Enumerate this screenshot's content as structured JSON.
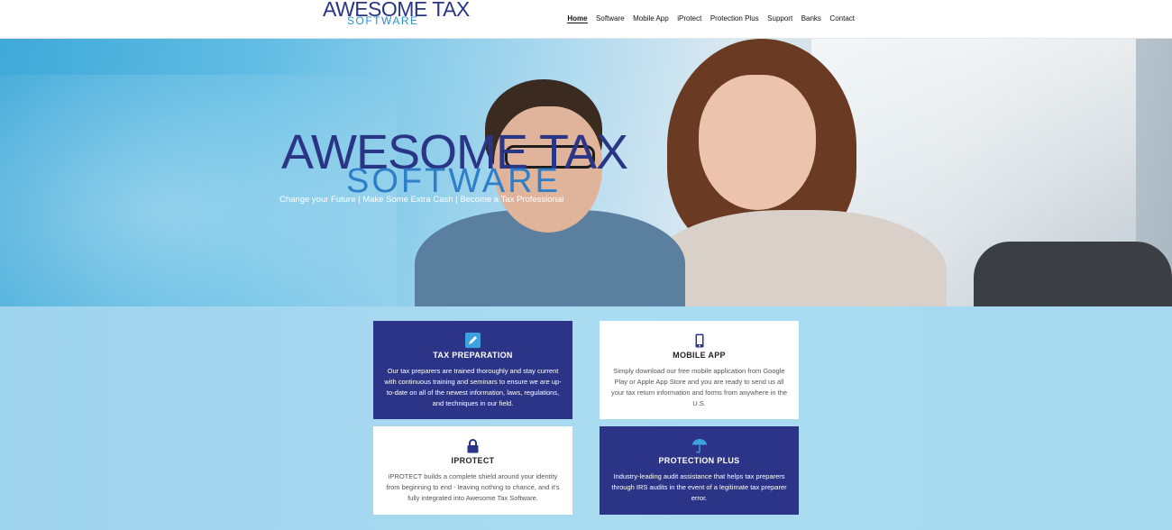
{
  "header": {
    "logo_top": "AWESOME TAX",
    "logo_bottom": "SOFTWARE",
    "nav": [
      {
        "label": "Home",
        "active": true
      },
      {
        "label": "Software"
      },
      {
        "label": "Mobile App"
      },
      {
        "label": "iProtect"
      },
      {
        "label": "Protection Plus"
      },
      {
        "label": "Support"
      },
      {
        "label": "Banks"
      },
      {
        "label": "Contact"
      }
    ]
  },
  "hero": {
    "title_line1": "AWESOME TAX",
    "title_line2": "SOFTWARE",
    "tagline": "Change your Future | Make Some Extra Cash | Become a Tax Professional"
  },
  "features": [
    {
      "title": "TAX PREPARATION",
      "text": "Our tax preparers are trained thoroughly and stay current with continuous training and seminars to ensure we are up-to-date on all of the newest information, laws, regulations, and techniques in our field.",
      "icon": "pencil-icon",
      "style": "dark"
    },
    {
      "title": "MOBILE APP",
      "text": "Simply download our free mobile application from Google Play or Apple App Store and you are ready to send us all your tax return information and forms from anywhere in the U.S.",
      "icon": "mobile-phone-icon",
      "style": "light"
    },
    {
      "title": "IPROTECT",
      "text": "iPROTECT builds a complete shield around your identity from beginning to end - leaving nothing to chance, and it's fully integrated into Awesome Tax Software.",
      "icon": "lock-icon",
      "style": "light"
    },
    {
      "title": "PROTECTION PLUS",
      "text": "Industry-leading audit assistance that helps tax preparers through IRS audits in the event of a legitimate tax preparer error.",
      "icon": "umbrella-icon",
      "style": "dark"
    }
  ],
  "colors": {
    "brand_navy": "#2b3486",
    "brand_blue": "#2f7ec8",
    "icon_blue": "#3ea1e0",
    "section_bg": "#a6d9f0"
  }
}
